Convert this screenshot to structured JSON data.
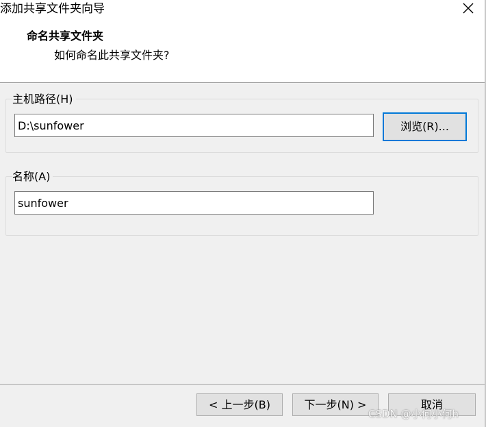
{
  "window": {
    "title": "添加共享文件夹向导"
  },
  "header": {
    "heading": "命名共享文件夹",
    "subheading": "如何命名此共享文件夹?"
  },
  "host_path": {
    "group_label": "主机路径(H)",
    "value": "D:\\sunfower",
    "browse_label": "浏览(R)..."
  },
  "name": {
    "group_label": "名称(A)",
    "value": "sunfower"
  },
  "footer": {
    "back_label": "< 上一步(B)",
    "next_label": "下一步(N) >",
    "cancel_label": "取消"
  },
  "watermark": "CSDN @小何小何h",
  "icons": {
    "close": "close-icon"
  },
  "colors": {
    "background": "#f0f0f0",
    "header_background": "#ffffff",
    "focus_accent": "#0078d7",
    "button_face": "#e1e1e1"
  }
}
